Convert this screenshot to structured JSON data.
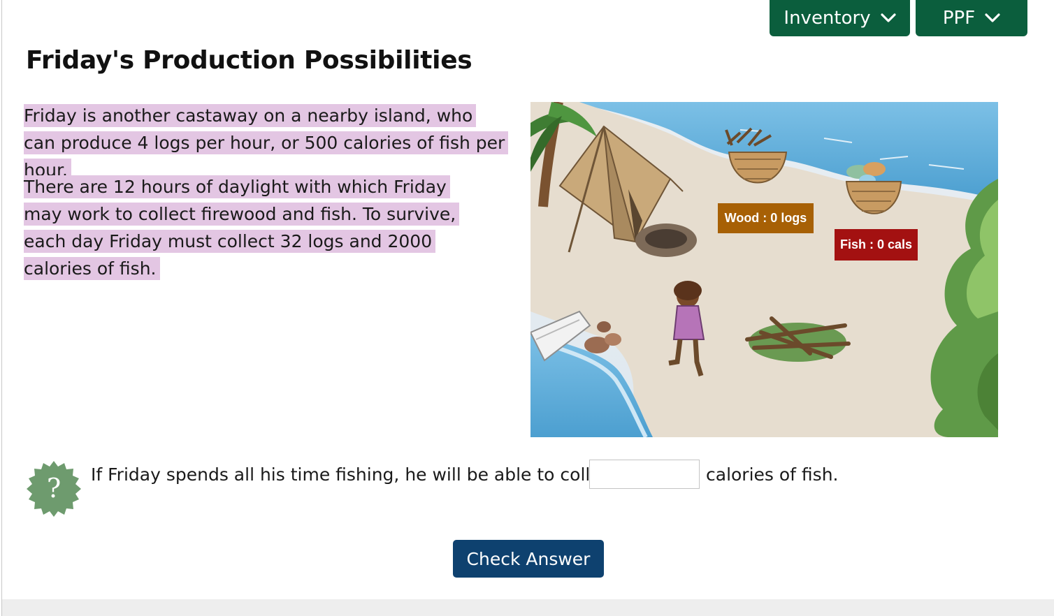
{
  "header": {
    "inventory_label": "Inventory",
    "ppf_label": "PPF"
  },
  "page": {
    "title": "Friday's Production Possibilities"
  },
  "intro": {
    "paragraph1": "Friday is another castaway on a nearby island, who can produce 4 logs per hour, or 500 calories of fish per hour.",
    "paragraph2": "There are 12 hours of daylight with which Friday may work to collect firewood and fish. To survive, each day Friday must collect 32 logs and 2000 calories of fish."
  },
  "scene": {
    "wood_label": "Wood : 0 logs",
    "fish_label": "Fish : 0 cals",
    "colors": {
      "sand": "#e6ddcf",
      "water": "#5ba8d6",
      "wood_tag": "#a76005",
      "fish_tag": "#a31111"
    },
    "icons": [
      "tent-icon",
      "fire-pit-icon",
      "wood-basket-icon",
      "fish-basket-icon",
      "castaway-figure",
      "boat-icon",
      "branch-pile-icon",
      "bush-icon",
      "palm-tree-icon"
    ]
  },
  "question": {
    "text_before": "If Friday spends all his time fishing, he will be able to collect",
    "text_after": "calories of fish.",
    "answer_value": "",
    "help_glyph": "?"
  },
  "actions": {
    "check_label": "Check Answer"
  },
  "colors": {
    "primary_green": "#0b5e3d",
    "primary_blue": "#0e416f",
    "highlight": "#e3c6e3",
    "help_badge": "#6e9b6e"
  }
}
